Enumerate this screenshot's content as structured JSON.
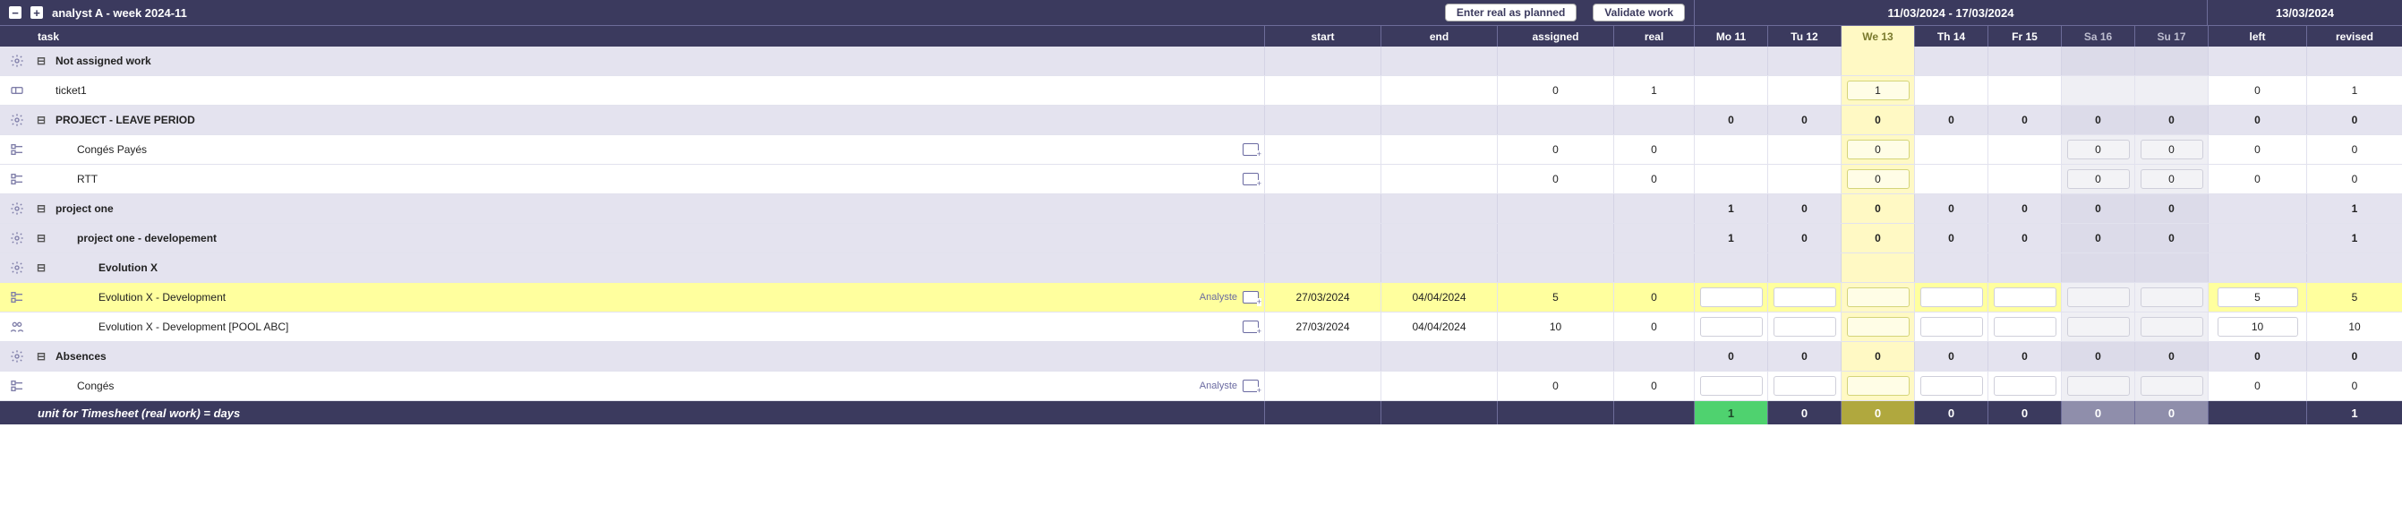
{
  "header": {
    "title": "analyst A - week 2024-11",
    "btn_enter_real": "Enter real as planned",
    "btn_validate": "Validate work",
    "date_range": "11/03/2024 - 17/03/2024",
    "today_date": "13/03/2024"
  },
  "columns": {
    "task": "task",
    "start": "start",
    "end": "end",
    "assigned": "assigned",
    "real": "real",
    "days": [
      "Mo 11",
      "Tu 12",
      "We 13",
      "Th 14",
      "Fr 15",
      "Sa 16",
      "Su 17"
    ],
    "left": "left",
    "revised": "revised"
  },
  "rows": [
    {
      "id": "not_assigned",
      "type": "summary",
      "icon": "gear-icon",
      "indent": 0,
      "task": "Not assigned work"
    },
    {
      "id": "ticket1",
      "type": "leaf",
      "icon": "ticket-icon",
      "indent": 0,
      "task": "ticket1",
      "assigned": "0",
      "real": "1",
      "day_inputs": [
        null,
        null,
        "1",
        null,
        null,
        null,
        null
      ],
      "left": "0",
      "revised": "1"
    },
    {
      "id": "leave_period",
      "type": "summary",
      "icon": "gear-icon",
      "indent": 0,
      "task": "PROJECT - LEAVE PERIOD",
      "days": [
        "0",
        "0",
        "0",
        "0",
        "0",
        "0",
        "0"
      ],
      "left": "0",
      "revised": "0"
    },
    {
      "id": "conges_payes",
      "type": "leaf",
      "icon": "task-icon",
      "indent": 1,
      "task": "Congés Payés",
      "has_comment": true,
      "assigned": "0",
      "real": "0",
      "day_inputs": [
        null,
        null,
        "0",
        null,
        null,
        "0",
        "0"
      ],
      "left": "0",
      "revised": "0"
    },
    {
      "id": "rtt",
      "type": "leaf",
      "icon": "task-icon",
      "indent": 1,
      "task": "RTT",
      "has_comment": true,
      "assigned": "0",
      "real": "0",
      "day_inputs": [
        null,
        null,
        "0",
        null,
        null,
        "0",
        "0"
      ],
      "left": "0",
      "revised": "0"
    },
    {
      "id": "project_one",
      "type": "summary",
      "icon": "gear-icon",
      "indent": 0,
      "task": "project one",
      "days": [
        "1",
        "0",
        "0",
        "0",
        "0",
        "0",
        "0"
      ],
      "left": "",
      "revised": "1"
    },
    {
      "id": "project_one_dev",
      "type": "summary",
      "icon": "gear-icon",
      "indent": 1,
      "task": "project one - developement",
      "days": [
        "1",
        "0",
        "0",
        "0",
        "0",
        "0",
        "0"
      ],
      "left": "",
      "revised": "1"
    },
    {
      "id": "evolution_x",
      "type": "summary",
      "icon": "gear-icon",
      "indent": 2,
      "task": "Evolution X"
    },
    {
      "id": "evox_dev",
      "type": "leaf",
      "highlight": true,
      "icon": "task-icon",
      "indent": 2,
      "task": "Evolution X - Development",
      "right_label": "Analyste",
      "has_comment": true,
      "start": "27/03/2024",
      "end": "04/04/2024",
      "assigned": "5",
      "real": "0",
      "day_inputs": [
        "",
        "",
        "",
        "",
        "",
        "",
        ""
      ],
      "left_input": "5",
      "revised": "5"
    },
    {
      "id": "evox_dev_pool",
      "type": "leaf",
      "icon": "pool-icon",
      "indent": 2,
      "task": "Evolution X - Development   [POOL ABC]",
      "has_comment": true,
      "start": "27/03/2024",
      "end": "04/04/2024",
      "assigned": "10",
      "real": "0",
      "day_inputs": [
        "",
        "",
        "",
        "",
        "",
        "",
        ""
      ],
      "left_input": "10",
      "revised": "10"
    },
    {
      "id": "absences",
      "type": "summary",
      "icon": "gear-icon",
      "indent": 0,
      "task": "Absences",
      "days": [
        "0",
        "0",
        "0",
        "0",
        "0",
        "0",
        "0"
      ],
      "left": "0",
      "revised": "0"
    },
    {
      "id": "conges",
      "type": "leaf",
      "icon": "task-icon",
      "indent": 1,
      "task": "Congés",
      "right_label": "Analyste",
      "has_comment": true,
      "assigned": "0",
      "real": "0",
      "day_inputs": [
        "",
        "",
        "",
        "",
        "",
        "",
        ""
      ],
      "left": "0",
      "revised": "0"
    }
  ],
  "footer": {
    "label": "unit for Timesheet (real work) = days",
    "days": [
      "1",
      "0",
      "0",
      "0",
      "0",
      "0",
      "0"
    ],
    "revised": "1"
  }
}
